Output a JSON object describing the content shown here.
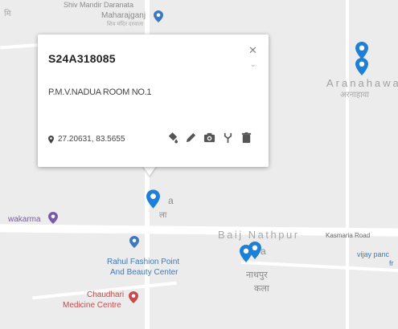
{
  "map": {
    "labels": {
      "shiv_mandir": "Shiv Mandir Daranata",
      "maharajganj": "Maharajganj",
      "maharajganj_hi": "शिव मंदिर दरवाता",
      "aranahawa": "Aranahawa",
      "aranahawa_hi": "अरनाहावा",
      "vishwakarma": "wakarma",
      "baij_nathpur": "Baij Nathpur",
      "baij_nathpur_hi": "नाथपुर",
      "baij_nathpur_hi2": "कला",
      "kasmaria_road": "Kasmaria Road",
      "vijay": "vijay panc",
      "vijay2": "fr",
      "rahul_line1": "Rahul Fashion Point",
      "rahul_line2": "And Beauty Center",
      "chaudhari_line1": "Chaudhari",
      "chaudhari_line2": "Medicine Centre",
      "near_pin_a": "a",
      "near_pin_hi": "ला",
      "near_pin_b": "a",
      "top_left": "मि"
    },
    "colors": {
      "pin": "#1e7fd6",
      "poi_purple": "#7a5aa8",
      "poi_blue": "#3b78c2",
      "poi_red": "#c9494b"
    }
  },
  "popup": {
    "title": "S24A318085",
    "subtitle": "P.M.V.NADUA ROOM NO.1",
    "coords": "27.20631, 83.5655",
    "icons": [
      "pin-icon",
      "fill-bucket-icon",
      "pencil-icon",
      "camera-icon",
      "fork-icon",
      "trash-icon",
      "close-icon"
    ]
  }
}
